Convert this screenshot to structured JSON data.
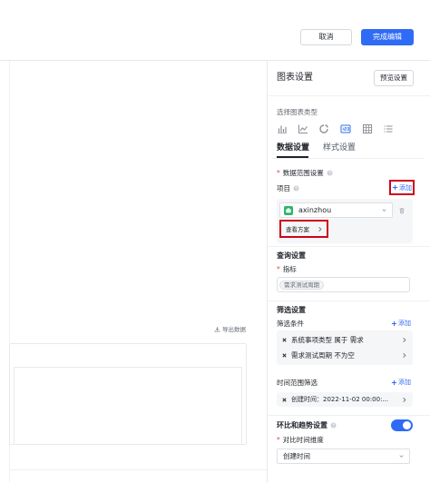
{
  "colors": {
    "primary": "#2f6bf5",
    "highlight": "#d0021b",
    "required": "#e5484d",
    "avatar": "#2fb36a"
  },
  "header": {
    "cancel_label": "取消",
    "done_label": "完成编辑"
  },
  "canvas": {
    "export_label": "导出数据",
    "export_icon": "download-icon"
  },
  "panel": {
    "title": "图表设置",
    "preview_label": "预览设置",
    "required_mark": "*",
    "chart_type_label": "选择图表类型",
    "chart_types": [
      {
        "icon": "bar-chart-icon"
      },
      {
        "icon": "line-chart-icon"
      },
      {
        "icon": "ring-chart-icon"
      },
      {
        "icon": "number-card-icon"
      },
      {
        "icon": "table-chart-icon"
      },
      {
        "icon": "list-chart-icon"
      }
    ],
    "selected_chart_type": 3,
    "tabs": [
      {
        "label": "数据设置",
        "active": true
      },
      {
        "label": "样式设置",
        "active": false
      }
    ],
    "data_scope": {
      "label": "数据范围设置",
      "project_label": "项目",
      "add_label": "添加",
      "project_value": "axinzhou",
      "view_plan_label": "查看方案"
    },
    "query": {
      "title": "查询设置",
      "metric_label": "指标",
      "metric_tags": [
        "需求测试周期"
      ]
    },
    "filter": {
      "title": "筛选设置",
      "condition_label": "筛选条件",
      "add_label": "添加",
      "conditions": [
        "系统事项类型 属于 需求",
        "需求测试周期 不为空"
      ],
      "time_range_label": "时间范围筛选",
      "time_add_label": "添加",
      "time_ranges": [
        "创建时间：2022-11-02 00:00:..."
      ]
    },
    "trend": {
      "label": "环比和趋势设置",
      "enabled": true,
      "dimension_label": "对比时间维度",
      "dimension_value": "创建时间"
    }
  }
}
